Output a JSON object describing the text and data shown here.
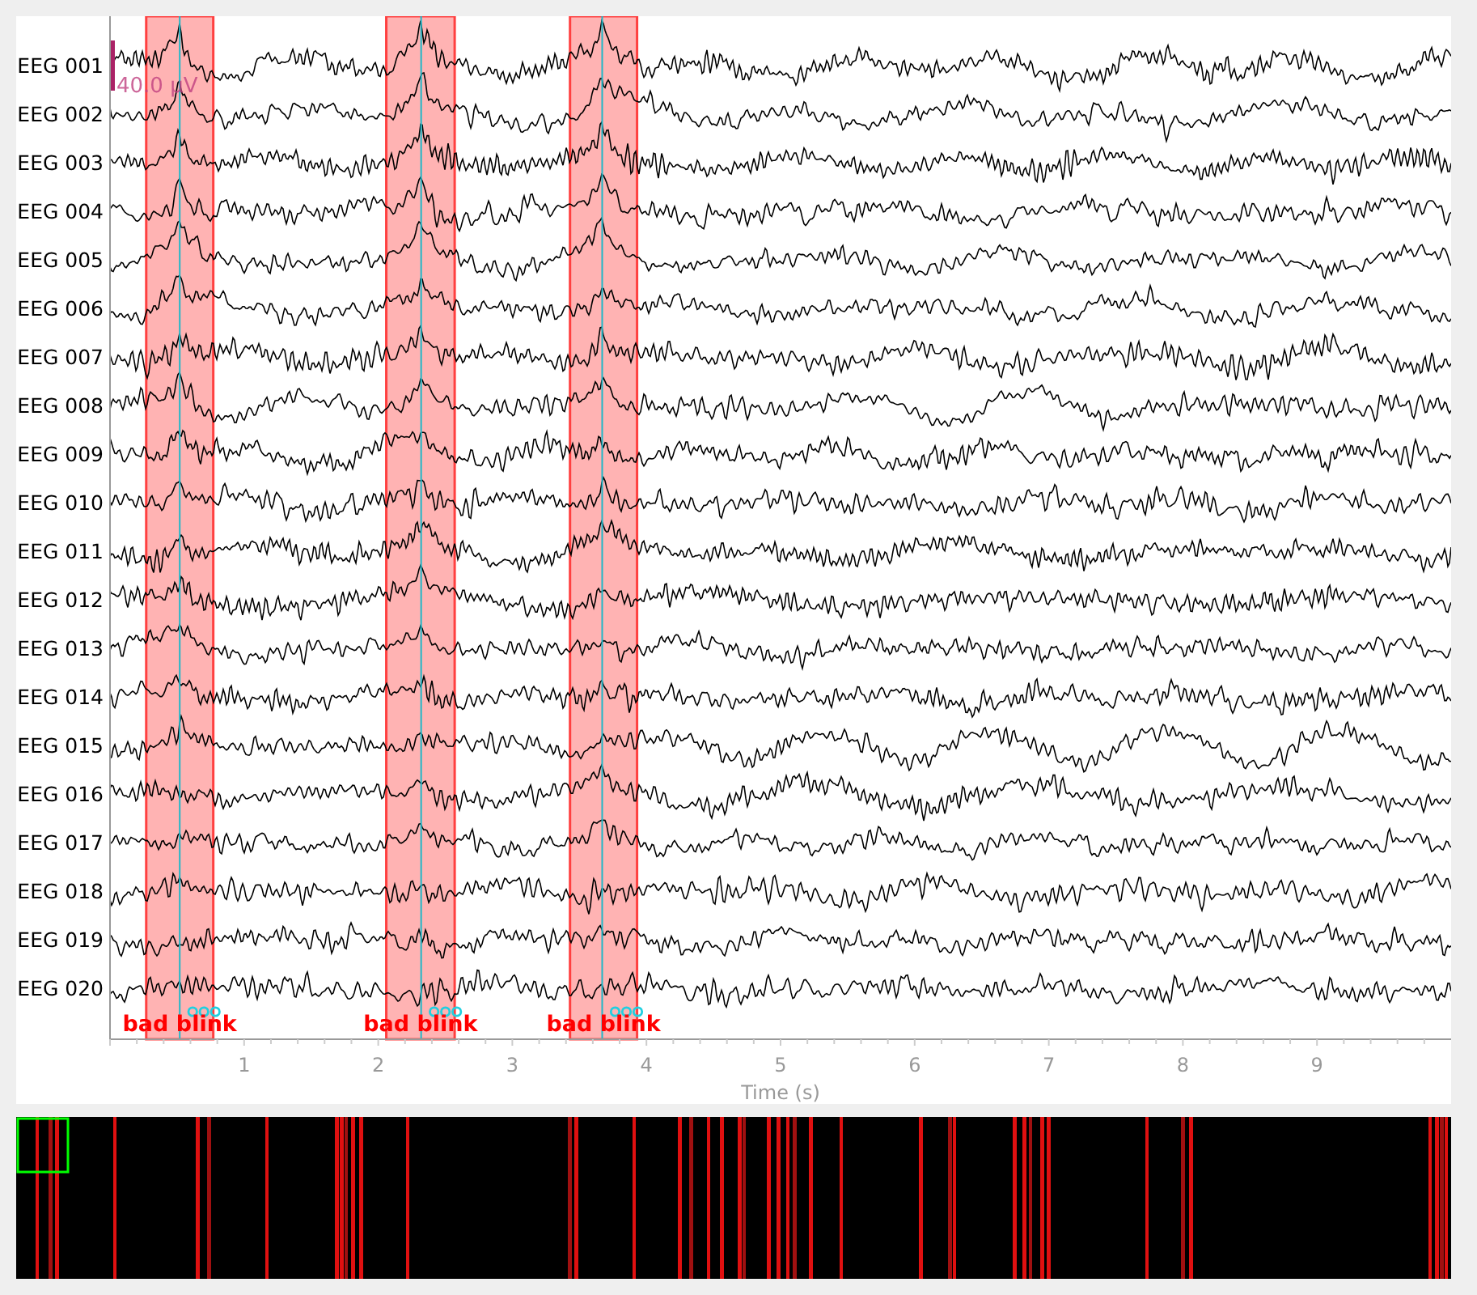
{
  "channels": [
    "EEG 001",
    "EEG 002",
    "EEG 003",
    "EEG 004",
    "EEG 005",
    "EEG 006",
    "EEG 007",
    "EEG 008",
    "EEG 009",
    "EEG 010",
    "EEG 011",
    "EEG 012",
    "EEG 013",
    "EEG 014",
    "EEG 015",
    "EEG 016",
    "EEG 017",
    "EEG 018",
    "EEG 019",
    "EEG 020"
  ],
  "scale_bar": {
    "label": "40.0 µV"
  },
  "annotations": [
    {
      "label": "bad blink"
    },
    {
      "label": "bad blink"
    },
    {
      "label": "bad blink"
    }
  ],
  "x_axis": {
    "label": "Time (s)",
    "ticks": [
      "1",
      "2",
      "3",
      "4",
      "5",
      "6",
      "7",
      "8",
      "9"
    ]
  }
}
